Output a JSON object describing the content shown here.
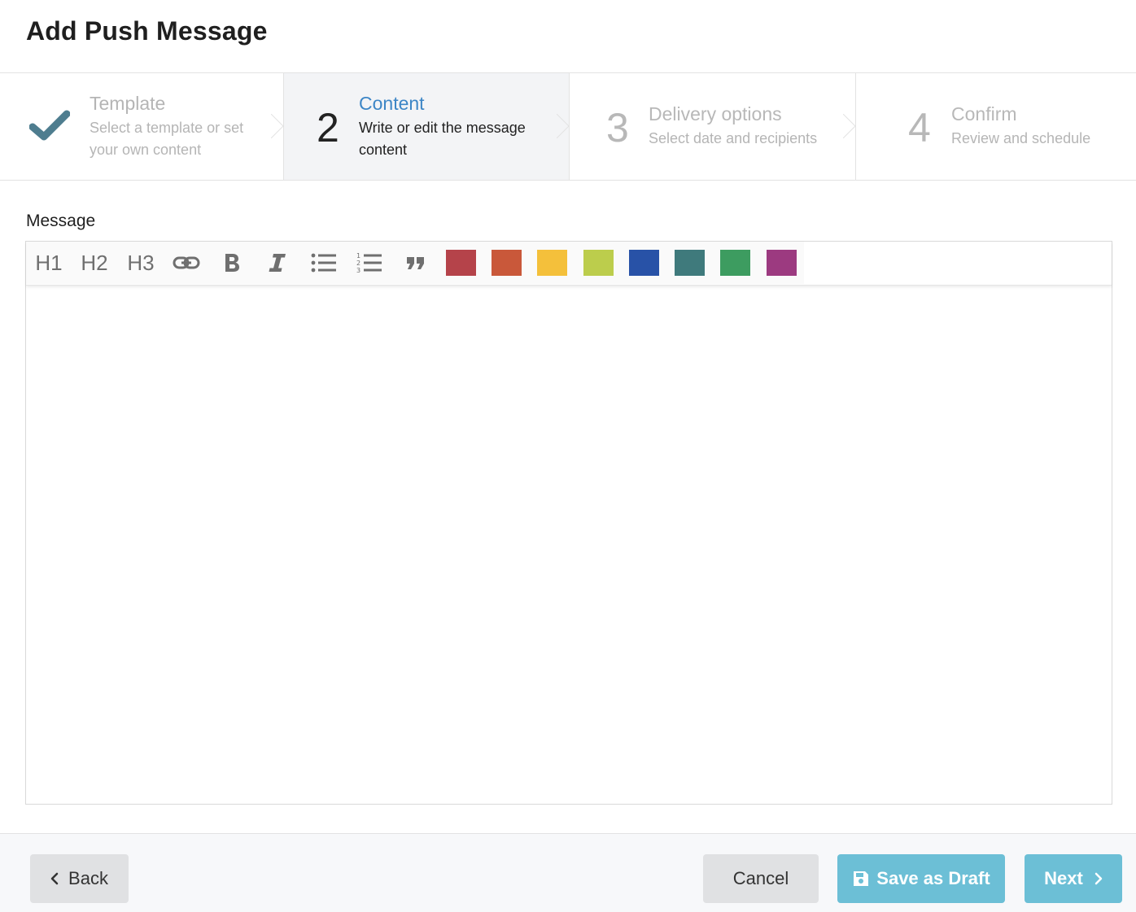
{
  "page": {
    "title": "Add Push Message"
  },
  "steps": [
    {
      "number": "",
      "title": "Template",
      "description": "Select a template or set your own content",
      "state": "completed",
      "icon": "check-icon"
    },
    {
      "number": "2",
      "title": "Content",
      "description": "Write or edit the message content",
      "state": "active"
    },
    {
      "number": "3",
      "title": "Delivery options",
      "description": "Select date and recipients",
      "state": "pending"
    },
    {
      "number": "4",
      "title": "Confirm",
      "description": "Review and schedule",
      "state": "pending"
    }
  ],
  "editor": {
    "label": "Message",
    "content": "",
    "toolbar": {
      "h1": "H1",
      "h2": "H2",
      "h3": "H3",
      "icons": [
        "link-icon",
        "bold-icon",
        "italic-icon",
        "bulleted-list-icon",
        "numbered-list-icon",
        "quote-icon"
      ],
      "colors": [
        "#b5434a",
        "#c9583a",
        "#f4c03b",
        "#bccd4c",
        "#2852a7",
        "#3f7a7c",
        "#3d9c60",
        "#9c3a80"
      ]
    }
  },
  "footer": {
    "back_label": "Back",
    "cancel_label": "Cancel",
    "draft_label": "Save as Draft",
    "next_label": "Next"
  },
  "colors": {
    "accent": "#3d86c6",
    "primary_button": "#6cbfd6",
    "secondary_button": "#e0e1e3",
    "check": "#4e7d8f"
  }
}
